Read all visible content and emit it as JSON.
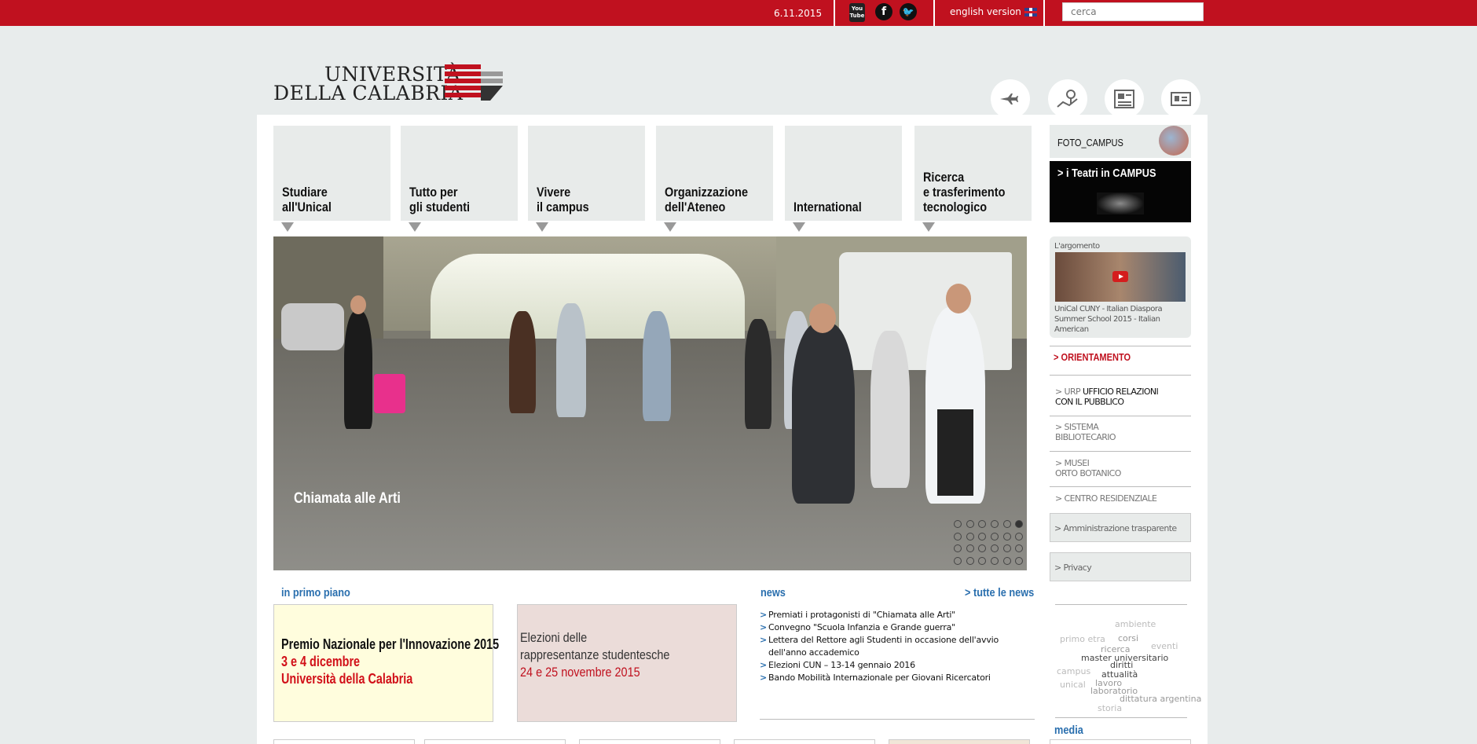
{
  "topbar": {
    "date": "6.11.2015",
    "english_label": "english version",
    "search_placeholder": "cerca",
    "youtube_top": "You",
    "youtube_bottom": "Tube",
    "facebook_glyph": "f",
    "twitter_glyph": "🐦"
  },
  "logo": {
    "line1": "UNIVERSITÀ",
    "line2": "DELLA CALABRIA"
  },
  "header_icons": [
    "transport-icon",
    "map-pin-icon",
    "newspaper-icon",
    "id-card-icon"
  ],
  "nav": [
    {
      "label": "Studiare\nall'Unical"
    },
    {
      "label": "Tutto per\ngli studenti"
    },
    {
      "label": "Vivere\nil campus"
    },
    {
      "label": "Organizzazione\ndell'Ateneo"
    },
    {
      "label": "International"
    },
    {
      "label": "Ricerca\ne trasferimento\ntecnologico"
    }
  ],
  "hero": {
    "caption": "Chiamata alle Arti",
    "slide_count": 24,
    "active_slide": 5
  },
  "right": {
    "foto_label": "FOTO_CAMPUS",
    "teatri_label": "> i Teatri in CAMPUS",
    "argomento_title": "L'argomento",
    "argomento_desc": "UniCal CUNY - Italian Diaspora Summer School 2015 - Italian American",
    "orientamento": "> ORIENTAMENTO",
    "urp_prefix": "> URP ",
    "urp_text": "UFFICIO RELAZIONI\nCON IL PUBBLICO",
    "sistema": "> SISTEMA\n   BIBLIOTECARIO",
    "musei": "> MUSEI\n   ORTO BOTANICO",
    "centro": "> CENTRO RESIDENZIALE",
    "amministrazione": "> Amministrazione trasparente",
    "privacy": "> Privacy"
  },
  "tags": [
    "ambiente",
    "primo etra",
    "corsi",
    "ricerca",
    "eventi",
    "master universitario",
    "campus",
    "diritti",
    "attualità",
    "unical",
    "lavoro",
    "laboratorio",
    "dittatura argentina",
    "storia"
  ],
  "primo_piano": {
    "title": "in primo piano",
    "premio": {
      "l1": "Premio Nazionale per l'Innovazione 2015",
      "l2": "3 e 4 dicembre",
      "l3": "Università della Calabria"
    },
    "elezioni": {
      "l1": "Elezioni delle",
      "l2": "rappresentanze studentesche",
      "l3": "24 e 25 novembre 2015"
    }
  },
  "news": {
    "title": "news",
    "all_link": "> tutte le news",
    "items": [
      "Premiati i protagonisti di \"Chiamata alle Arti\"",
      "Convegno \"Scuola Infanzia e Grande guerra\"",
      "Lettera del Rettore agli Studenti in occasione dell'avvio dell'anno accademico",
      "Elezioni CUN – 13-14 gennaio 2016",
      "Bando Mobilità Internazionale per Giovani Ricercatori"
    ]
  },
  "media_title": "media",
  "colors": {
    "brand_red": "#c0111f",
    "link_blue": "#2a6fae",
    "bg": "#e8ecec"
  }
}
